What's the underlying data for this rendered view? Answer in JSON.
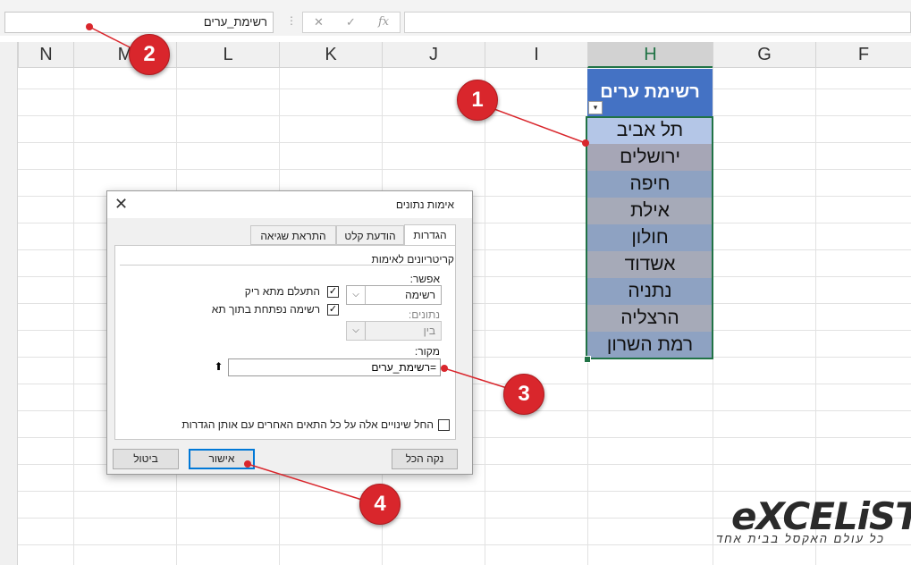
{
  "formula_bar": {
    "name_box": "רשימת_ערים",
    "cancel_icon": "✕",
    "enter_icon": "✓",
    "fx_label": "fx",
    "separator": "⋮"
  },
  "columns": [
    {
      "label": "N"
    },
    {
      "label": "M"
    },
    {
      "label": "L"
    },
    {
      "label": "K"
    },
    {
      "label": "J"
    },
    {
      "label": "I"
    },
    {
      "label": "H"
    },
    {
      "label": "G"
    },
    {
      "label": "F"
    }
  ],
  "table": {
    "header": "רשימת ערים",
    "dropdown_glyph": "▾",
    "cities": [
      "תל אביב",
      "ירושלים",
      "חיפה",
      "אילת",
      "חולון",
      "אשדוד",
      "נתניה",
      "הרצליה",
      "רמת השרון"
    ],
    "header_color": "#4472c4",
    "row_colors": [
      "#b4c6e7",
      "#a6a6b6",
      "#8ea2c2",
      "#a6aab8",
      "#8ea2c2",
      "#a6aab8",
      "#8ea2c2",
      "#a6aab8",
      "#8ea2c2"
    ]
  },
  "dialog": {
    "title": "אימות נתונים",
    "close_icon": "✕",
    "tabs": [
      {
        "label": "הגדרות",
        "active": true
      },
      {
        "label": "הודעת קלט",
        "active": false
      },
      {
        "label": "התראת שגיאה",
        "active": false
      }
    ],
    "group_title": "קריטריונים לאימות",
    "allow_label": "אפשר:",
    "allow_value": "רשימה",
    "data_label": "נתונים:",
    "data_value": "בין",
    "ignore_blank_label": "התעלם מתא ריק",
    "ignore_blank_checked": true,
    "in_cell_dropdown_label": "רשימה נפתחת בתוך תא",
    "in_cell_dropdown_checked": true,
    "source_label": "מקור:",
    "source_value": "=רשימת_ערים",
    "source_collapse_glyph": "⬆",
    "apply_all_label": "החל שינויים אלה על כל התאים האחרים עם אותן הגדרות",
    "apply_all_checked": false,
    "clear_all_button": "נקה הכל",
    "ok_button": "אישור",
    "cancel_button": "ביטול",
    "check_glyph": "✓",
    "combo_arrow_glyph": "⌵"
  },
  "callouts": [
    "1",
    "2",
    "3",
    "4"
  ],
  "callout_color": "#d9262c",
  "logo": {
    "text": "eXCELiST",
    "slogan": "כל עולם האקסל בבית אחד"
  }
}
